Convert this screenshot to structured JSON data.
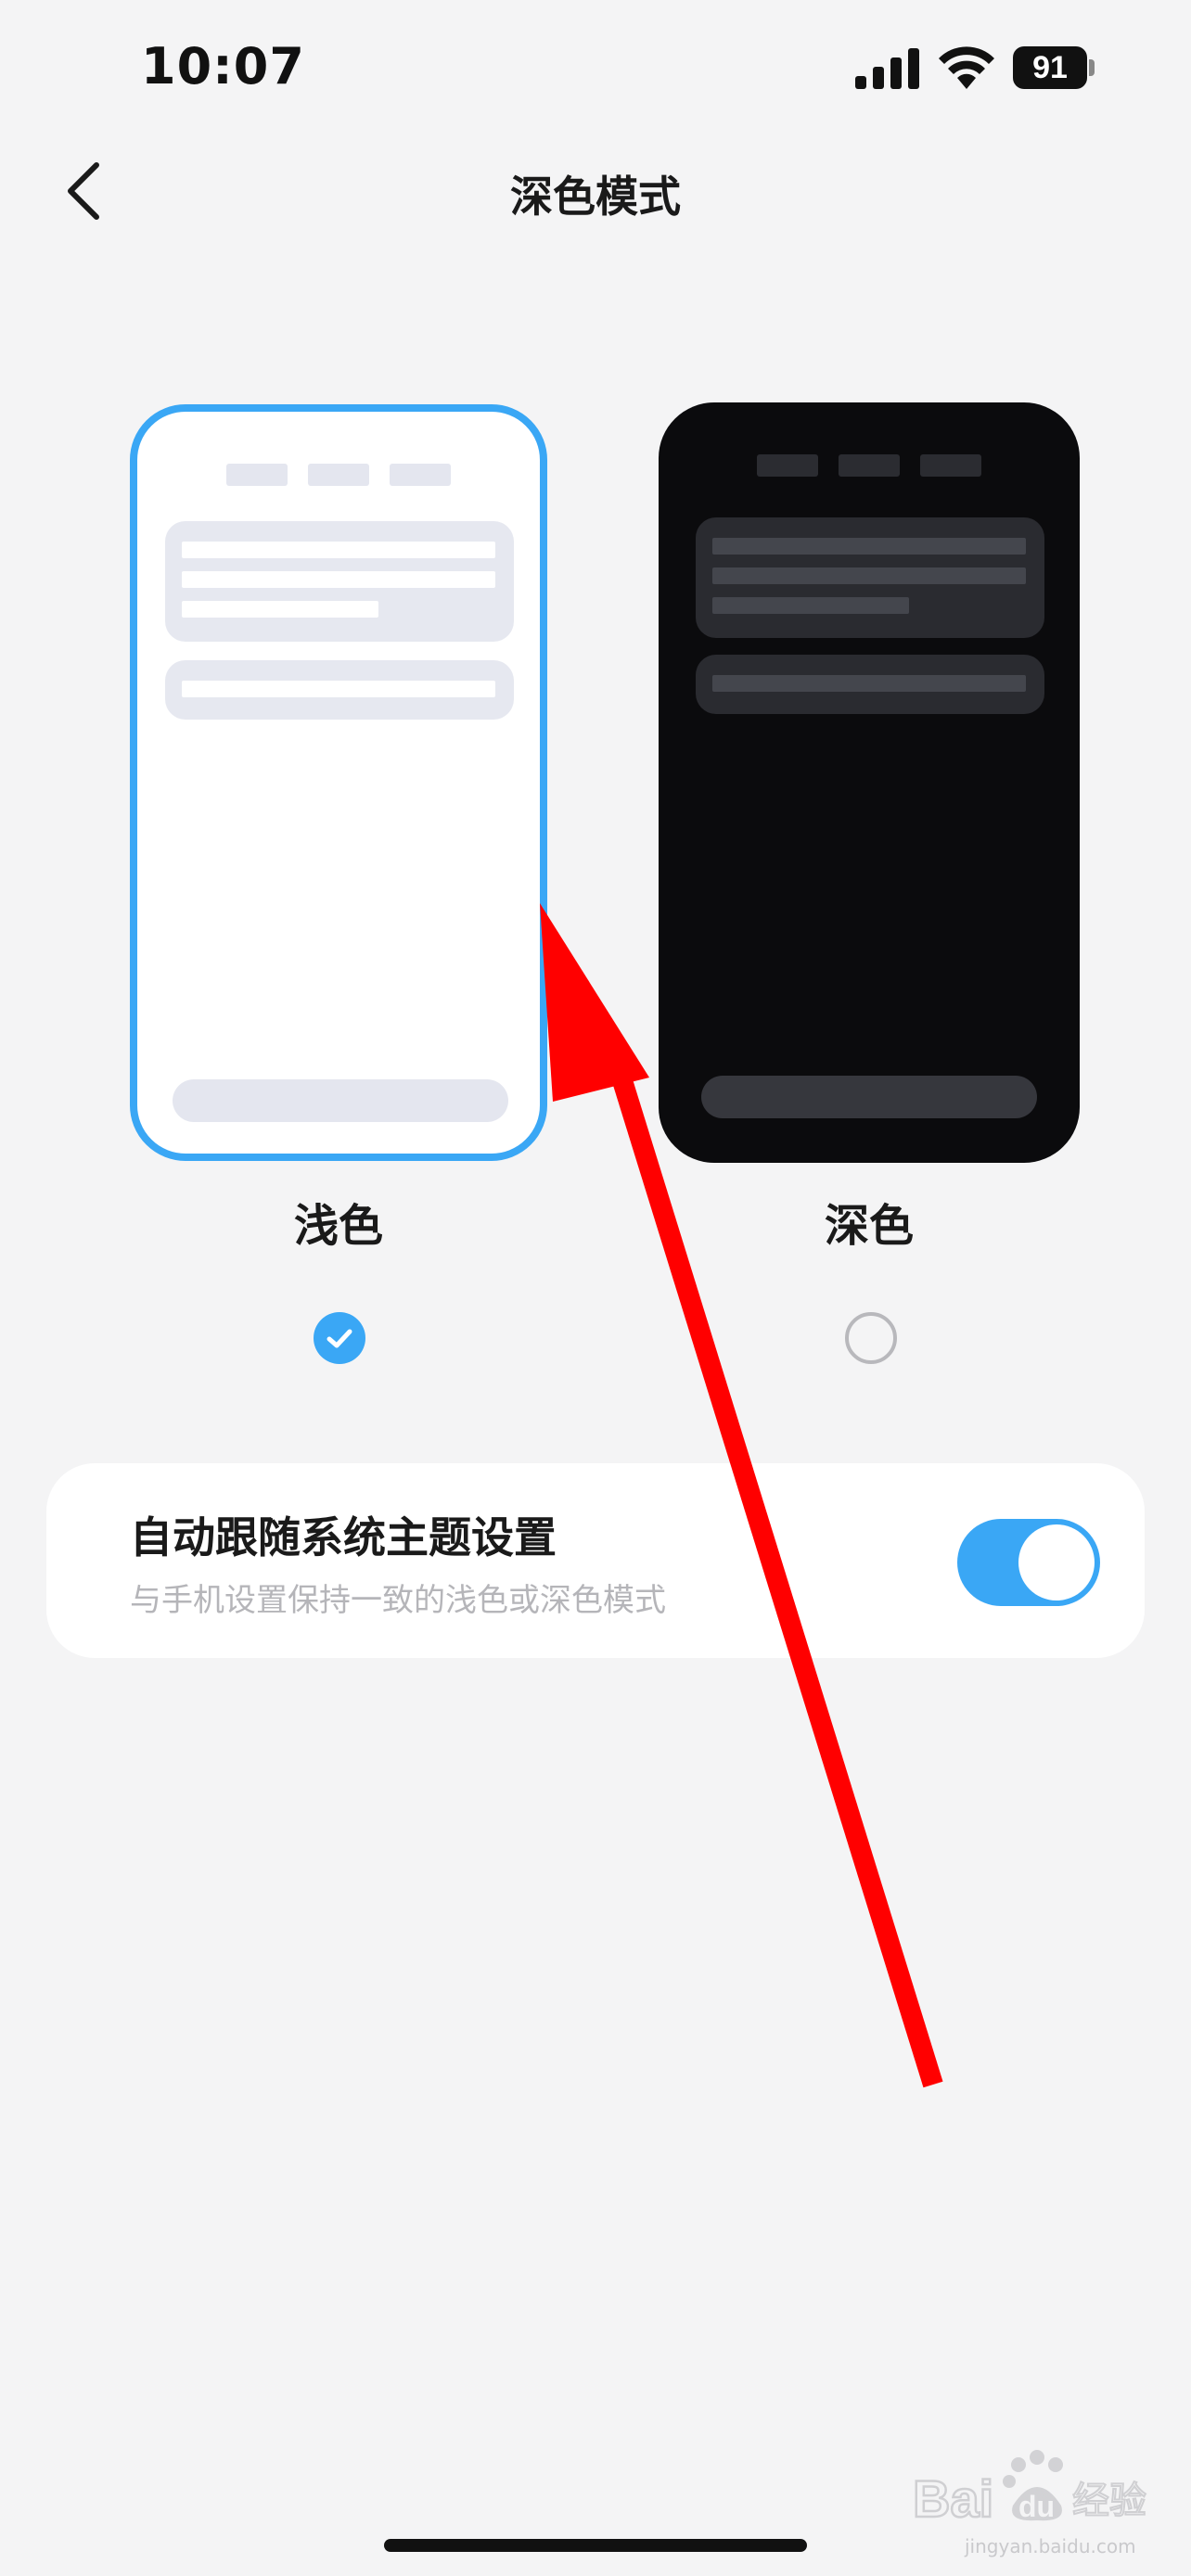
{
  "status_bar": {
    "time": "10:07",
    "battery_level": "91",
    "icons": [
      "signal-icon",
      "wifi-icon",
      "battery-icon"
    ]
  },
  "nav": {
    "title": "深色模式",
    "back_icon": "chevron-left-icon"
  },
  "themes": [
    {
      "label": "浅色",
      "selected": true
    },
    {
      "label": "深色",
      "selected": false
    }
  ],
  "auto_follow": {
    "title": "自动跟随系统主题设置",
    "subtitle": "与手机设置保持一致的浅色或深色模式",
    "enabled": true
  },
  "watermark": {
    "logo_text": "Bai du 经验",
    "url": "jingyan.baidu.com"
  },
  "colors": {
    "accent": "#3aa7f5",
    "annotation_arrow": "#ff0000",
    "background": "#f4f4f5",
    "dark_preview": "#0b0b0d"
  }
}
